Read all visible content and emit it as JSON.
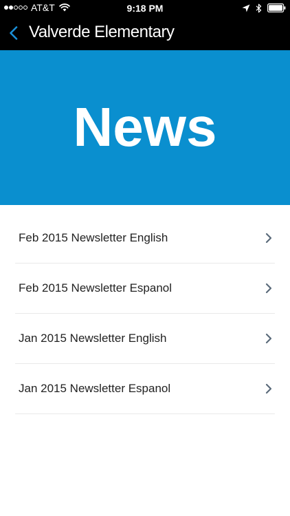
{
  "status_bar": {
    "carrier": "AT&T",
    "time": "9:18 PM",
    "signal_filled": 2,
    "signal_total": 5
  },
  "nav": {
    "title": "Valverde Elementary"
  },
  "hero": {
    "text": "News",
    "background": "#0a8fcf"
  },
  "news_items": [
    {
      "label": "Feb 2015 Newsletter English"
    },
    {
      "label": "Feb 2015 Newsletter Espanol"
    },
    {
      "label": "Jan 2015 Newsletter English"
    },
    {
      "label": "Jan 2015 Newsletter Espanol"
    }
  ],
  "colors": {
    "accent": "#1a8fd8",
    "chevron": "#5a6a7a"
  }
}
